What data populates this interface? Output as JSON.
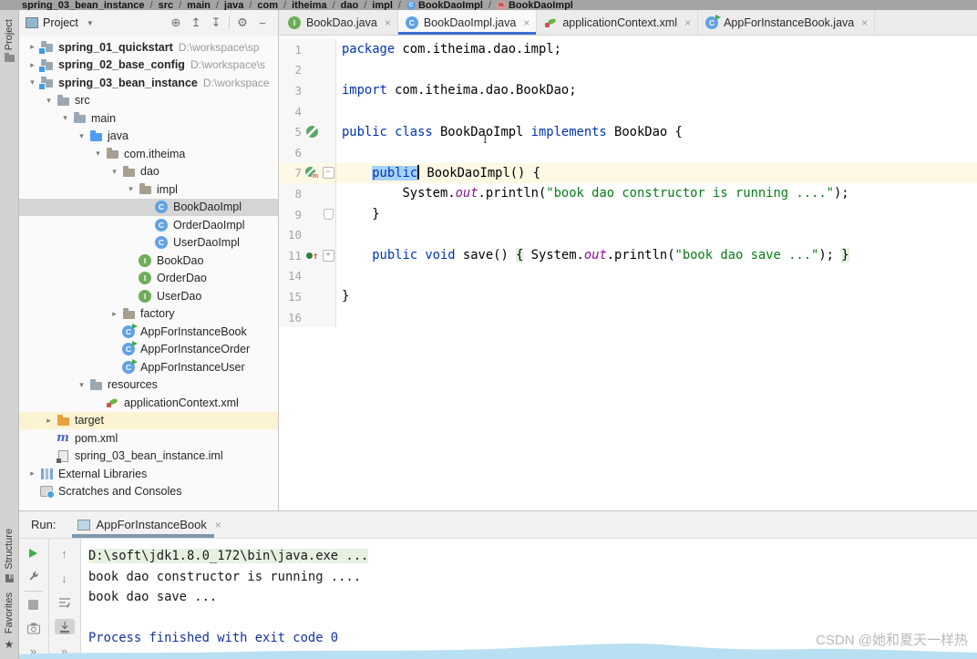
{
  "breadcrumb": {
    "items": [
      {
        "label": "spring_03_bean_instance"
      },
      {
        "label": "src"
      },
      {
        "label": "main"
      },
      {
        "label": "java"
      },
      {
        "label": "com"
      },
      {
        "label": "itheima"
      },
      {
        "label": "dao"
      },
      {
        "label": "impl"
      },
      {
        "label": "BookDaoImpl",
        "icon": "class"
      },
      {
        "label": "BookDaoImpl",
        "icon": "method"
      }
    ]
  },
  "tool_strip": {
    "project_label": "Project",
    "structure_label": "Structure",
    "favorites_label": "Favorites"
  },
  "project_panel": {
    "title": "Project",
    "header_icons": [
      "locate",
      "expand-all",
      "collapse-all",
      "divider",
      "settings",
      "hide"
    ]
  },
  "tree": {
    "items": [
      {
        "label": "spring_01_quickstart",
        "path": "D:\\workspace\\sp",
        "level": 0,
        "chevron": "collapsed",
        "icon": "module",
        "bold": true
      },
      {
        "label": "spring_02_base_config",
        "path": "D:\\workspace\\s",
        "level": 0,
        "chevron": "collapsed",
        "icon": "module",
        "bold": true
      },
      {
        "label": "spring_03_bean_instance",
        "path": "D:\\workspace",
        "level": 0,
        "chevron": "expanded",
        "icon": "module",
        "bold": true
      },
      {
        "label": "src",
        "level": 1,
        "chevron": "expanded",
        "icon": "folder"
      },
      {
        "label": "main",
        "level": 2,
        "chevron": "expanded",
        "icon": "folder"
      },
      {
        "label": "java",
        "level": 3,
        "chevron": "expanded",
        "icon": "folder-java"
      },
      {
        "label": "com.itheima",
        "level": 4,
        "chevron": "expanded",
        "icon": "package"
      },
      {
        "label": "dao",
        "level": 5,
        "chevron": "expanded",
        "icon": "package"
      },
      {
        "label": "impl",
        "level": 6,
        "chevron": "expanded",
        "icon": "package"
      },
      {
        "label": "BookDaoImpl",
        "level": 7,
        "icon": "class",
        "selected": true
      },
      {
        "label": "OrderDaoImpl",
        "level": 7,
        "icon": "class"
      },
      {
        "label": "UserDaoImpl",
        "level": 7,
        "icon": "class"
      },
      {
        "label": "BookDao",
        "level": 6,
        "icon": "interface"
      },
      {
        "label": "OrderDao",
        "level": 6,
        "icon": "interface"
      },
      {
        "label": "UserDao",
        "level": 6,
        "icon": "interface"
      },
      {
        "label": "factory",
        "level": 5,
        "chevron": "collapsed",
        "icon": "package"
      },
      {
        "label": "AppForInstanceBook",
        "level": 5,
        "icon": "class-run"
      },
      {
        "label": "AppForInstanceOrder",
        "level": 5,
        "icon": "class-run"
      },
      {
        "label": "AppForInstanceUser",
        "level": 5,
        "icon": "class-run"
      },
      {
        "label": "resources",
        "level": 3,
        "chevron": "expanded",
        "icon": "folder"
      },
      {
        "label": "applicationContext.xml",
        "level": 4,
        "icon": "spring"
      },
      {
        "label": "target",
        "level": 1,
        "chevron": "collapsed",
        "icon": "folder-target",
        "highlighted": true
      },
      {
        "label": "pom.xml",
        "level": 1,
        "icon": "maven"
      },
      {
        "label": "spring_03_bean_instance.iml",
        "level": 1,
        "icon": "iml"
      },
      {
        "label": "External Libraries",
        "level": 0,
        "chevron": "collapsed",
        "icon": "libraries"
      },
      {
        "label": "Scratches and Consoles",
        "level": 0,
        "icon": "scratches"
      }
    ]
  },
  "tabs": [
    {
      "label": "BookDao.java",
      "icon": "interface"
    },
    {
      "label": "BookDaoImpl.java",
      "icon": "class",
      "active": true
    },
    {
      "label": "applicationContext.xml",
      "icon": "spring"
    },
    {
      "label": "AppForInstanceBook.java",
      "icon": "class-run"
    }
  ],
  "editor": {
    "lines": [
      {
        "num": "1",
        "tokens": [
          [
            "kw",
            "package"
          ],
          [
            "pl",
            " com.itheima.dao.impl;"
          ]
        ]
      },
      {
        "num": "2",
        "tokens": []
      },
      {
        "num": "3",
        "tokens": [
          [
            "kw",
            "import"
          ],
          [
            "pl",
            " com.itheima.dao.BookDao;"
          ]
        ]
      },
      {
        "num": "4",
        "tokens": []
      },
      {
        "num": "5",
        "gutter": "implements",
        "tokens": [
          [
            "kw",
            "public class"
          ],
          [
            "pl",
            " BookDaoImpl "
          ],
          [
            "kw",
            "implements"
          ],
          [
            "pl",
            " BookDao {"
          ]
        ]
      },
      {
        "num": "6",
        "tokens": []
      },
      {
        "num": "7",
        "gutter": "constructor",
        "fold": "open",
        "current": true,
        "tokens": [
          [
            "pl",
            "    "
          ],
          [
            "kw sel",
            "public"
          ],
          [
            "caret",
            ""
          ],
          [
            "pl",
            " BookDaoImpl() {"
          ]
        ]
      },
      {
        "num": "8",
        "tokens": [
          [
            "pl",
            "        System."
          ],
          [
            "fld",
            "out"
          ],
          [
            "pl",
            ".println("
          ],
          [
            "str",
            "\"book dao constructor is running ....\""
          ],
          [
            "pl",
            ");"
          ]
        ]
      },
      {
        "num": "9",
        "fold": "end",
        "tokens": [
          [
            "pl",
            "    }"
          ]
        ]
      },
      {
        "num": "10",
        "tokens": []
      },
      {
        "num": "11",
        "gutter": "override",
        "fold": "closed",
        "tokens": [
          [
            "pl",
            "    "
          ],
          [
            "kw",
            "public void"
          ],
          [
            "pl",
            " save() "
          ],
          [
            "fbg",
            "{"
          ],
          [
            "pl",
            " System."
          ],
          [
            "fld",
            "out"
          ],
          [
            "pl",
            ".println("
          ],
          [
            "str",
            "\"book dao save ...\""
          ],
          [
            "pl",
            "); "
          ],
          [
            "fbg",
            "}"
          ]
        ]
      },
      {
        "num": "14",
        "tokens": []
      },
      {
        "num": "15",
        "tokens": [
          [
            "pl",
            "}"
          ]
        ]
      },
      {
        "num": "16",
        "tokens": []
      }
    ]
  },
  "run_panel": {
    "label": "Run:",
    "tab": {
      "label": "AppForInstanceBook"
    },
    "toolbar_main": [
      "rerun",
      "settings",
      "divider",
      "stop",
      "screenshot",
      "more"
    ],
    "toolbar_console": [
      "up-stack",
      "down-stack",
      "soft-wrap",
      "scroll-to-end",
      "more"
    ],
    "console": [
      {
        "style": "cmd",
        "text": "D:\\soft\\jdk1.8.0_172\\bin\\java.exe ..."
      },
      {
        "style": "plain",
        "text": "book dao constructor is running ...."
      },
      {
        "style": "plain",
        "text": "book dao save ..."
      },
      {
        "style": "plain",
        "text": ""
      },
      {
        "style": "system",
        "text": "Process finished with exit code 0"
      }
    ]
  },
  "watermark": "CSDN @她和夏天一样热"
}
